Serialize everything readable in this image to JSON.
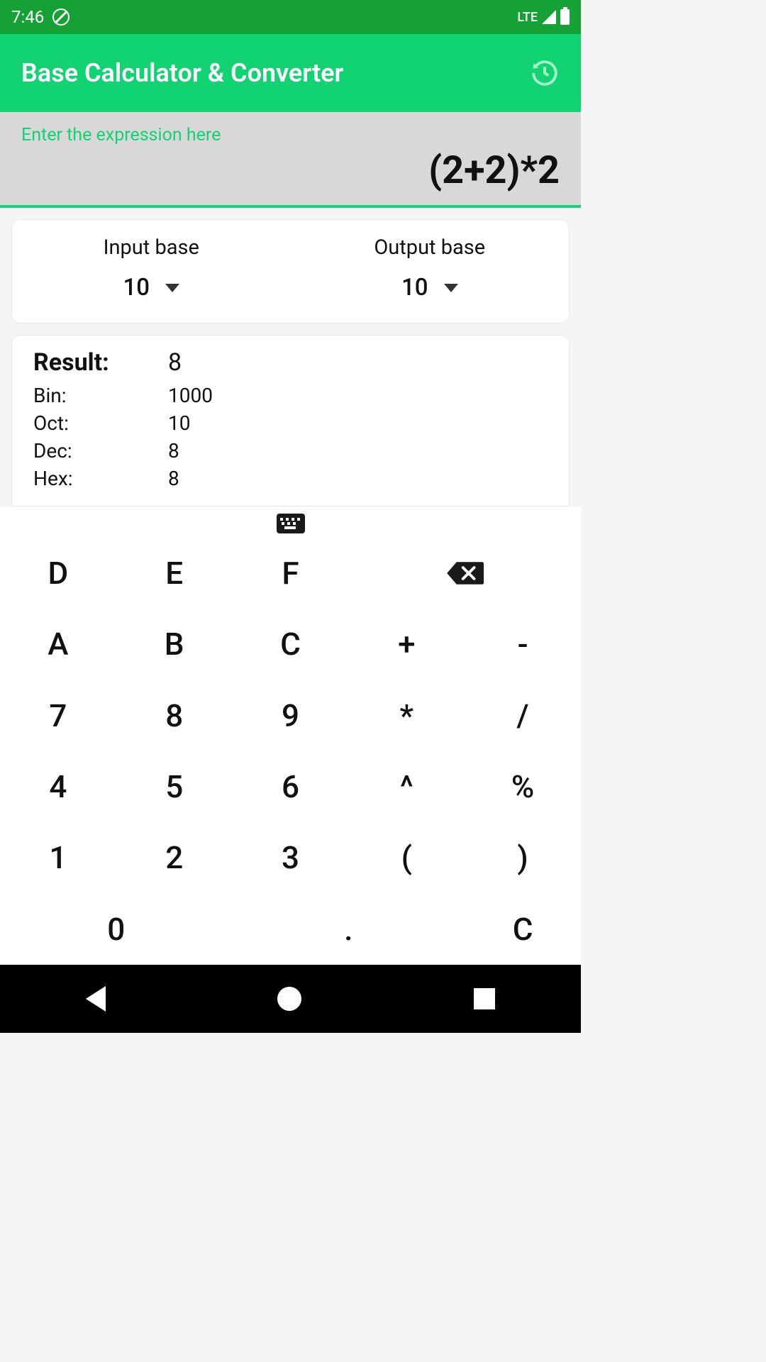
{
  "status": {
    "time": "7:46",
    "network": "LTE"
  },
  "app": {
    "title": "Base Calculator & Converter"
  },
  "expression": {
    "hint": "Enter the expression here",
    "value": "(2+2)*2"
  },
  "bases": {
    "input_label": "Input base",
    "input_value": "10",
    "output_label": "Output base",
    "output_value": "10"
  },
  "results": {
    "main_label": "Result:",
    "main_value": "8",
    "rows": [
      {
        "label": "Bin:",
        "value": "1000"
      },
      {
        "label": "Oct:",
        "value": "10"
      },
      {
        "label": "Dec:",
        "value": "8"
      },
      {
        "label": "Hex:",
        "value": "8"
      }
    ]
  },
  "keypad": {
    "keys": [
      "D",
      "E",
      "F",
      "",
      "⌫",
      "A",
      "B",
      "C",
      "+",
      "-",
      "7",
      "8",
      "9",
      "*",
      "/",
      "4",
      "5",
      "6",
      "^",
      "%",
      "1",
      "2",
      "3",
      "(",
      ")",
      "0",
      ".",
      "C"
    ],
    "layout": [
      {
        "t": "D"
      },
      {
        "t": "E"
      },
      {
        "t": "F"
      },
      {
        "t": "⌫",
        "span": 2,
        "name": "backspace-key"
      },
      {
        "t": "A"
      },
      {
        "t": "B"
      },
      {
        "t": "C"
      },
      {
        "t": "+"
      },
      {
        "t": "-"
      },
      {
        "t": "7"
      },
      {
        "t": "8"
      },
      {
        "t": "9"
      },
      {
        "t": "*"
      },
      {
        "t": "/"
      },
      {
        "t": "4"
      },
      {
        "t": "5"
      },
      {
        "t": "6"
      },
      {
        "t": "^"
      },
      {
        "t": "%"
      },
      {
        "t": "1"
      },
      {
        "t": "2"
      },
      {
        "t": "3"
      },
      {
        "t": "("
      },
      {
        "t": ")"
      },
      {
        "t": "0",
        "span": 2
      },
      {
        "t": ".",
        "span": 2
      },
      {
        "t": "C",
        "name": "clear-key"
      }
    ]
  }
}
